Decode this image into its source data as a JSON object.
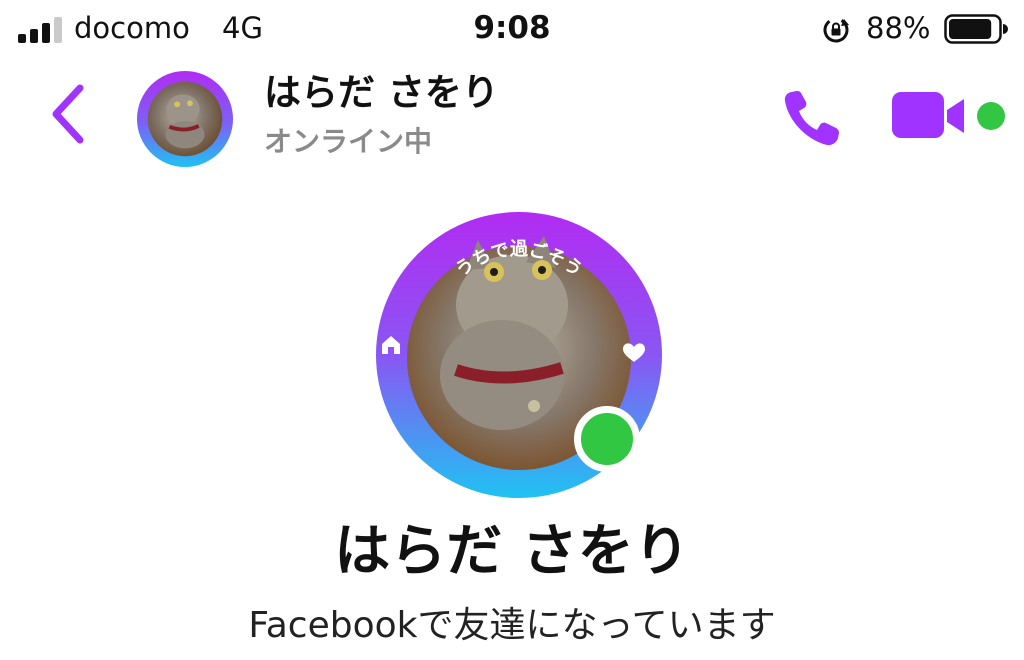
{
  "status_bar": {
    "carrier": "docomo",
    "network": "4G",
    "time": "9:08",
    "battery_percent": "88%",
    "battery_level": 0.88,
    "signal_bars": 3,
    "signal_bars_total": 4,
    "icons": [
      "signal-icon",
      "rotation-lock-icon",
      "battery-icon"
    ]
  },
  "header": {
    "name": "はらだ さをり",
    "status": "オンライン中",
    "back_icon": "chevron-left-icon",
    "call_icon": "phone-icon",
    "video_icon": "video-camera-icon",
    "online": true
  },
  "profile": {
    "name": "はらだ さをり",
    "subtitle": "Facebookで友達になっています",
    "frame_text": "うちで過ごそう",
    "frame_icons": [
      "home-icon",
      "heart-icon"
    ],
    "online": true
  },
  "colors": {
    "accent": "#a033ff",
    "online": "#31c743",
    "ring_top": "#b12cf2",
    "ring_bottom": "#1fc2f2",
    "secondary_text": "#8a8a8a"
  }
}
